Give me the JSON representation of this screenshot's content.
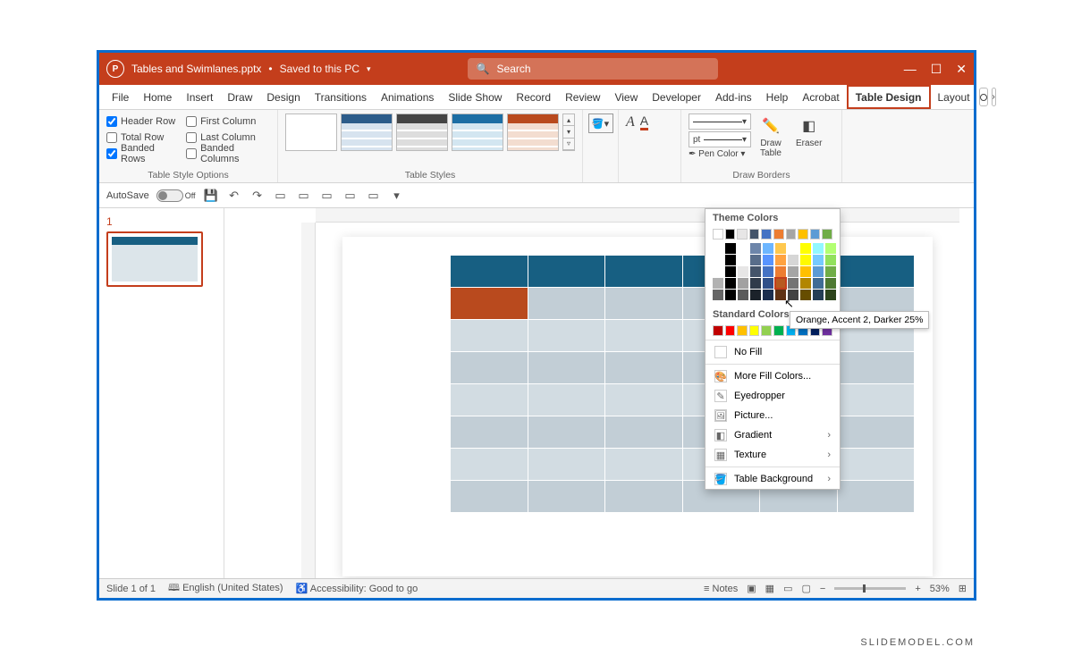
{
  "titlebar": {
    "filename": "Tables and Swimlanes.pptx",
    "saved_state": "Saved to this PC",
    "search_placeholder": "Search"
  },
  "tabs": [
    "File",
    "Home",
    "Insert",
    "Draw",
    "Design",
    "Transitions",
    "Animations",
    "Slide Show",
    "Record",
    "Review",
    "View",
    "Developer",
    "Add-ins",
    "Help",
    "Acrobat",
    "Table Design",
    "Layout"
  ],
  "active_tab": "Table Design",
  "ribbon": {
    "style_options": {
      "header_row": "Header Row",
      "total_row": "Total Row",
      "banded_rows": "Banded Rows",
      "first_column": "First Column",
      "last_column": "Last Column",
      "banded_columns": "Banded Columns",
      "group_label": "Table Style Options"
    },
    "table_styles_label": "Table Styles",
    "pen_pt": "pt",
    "pen_color": "Pen Color",
    "draw_table": "Draw\nTable",
    "eraser": "Eraser",
    "draw_borders_label": "Draw Borders"
  },
  "qat": {
    "autosave_label": "AutoSave",
    "autosave_state": "Off"
  },
  "slide_panel": {
    "slide_number": "1"
  },
  "flyout": {
    "theme_label": "Theme Colors",
    "standard_label": "Standard Colors",
    "theme_row": [
      "#ffffff",
      "#000000",
      "#e7e6e6",
      "#44546a",
      "#4472c4",
      "#ed7d31",
      "#a5a5a5",
      "#ffc000",
      "#5b9bd5",
      "#70ad47"
    ],
    "standard_row": [
      "#c00000",
      "#ff0000",
      "#ffc000",
      "#ffff00",
      "#92d050",
      "#00b050",
      "#00b0f0",
      "#0070c0",
      "#002060",
      "#7030a0"
    ],
    "no_fill": "No Fill",
    "more_colors": "More Fill Colors...",
    "eyedropper": "Eyedropper",
    "picture": "Picture...",
    "gradient": "Gradient",
    "texture": "Texture",
    "table_bg": "Table Background"
  },
  "tooltip": "Orange, Accent 2, Darker 25%",
  "statusbar": {
    "slide_info": "Slide 1 of 1",
    "language": "English (United States)",
    "accessibility": "Accessibility: Good to go",
    "notes": "Notes",
    "zoom": "53%"
  },
  "watermark": "SLIDEMODEL.COM"
}
